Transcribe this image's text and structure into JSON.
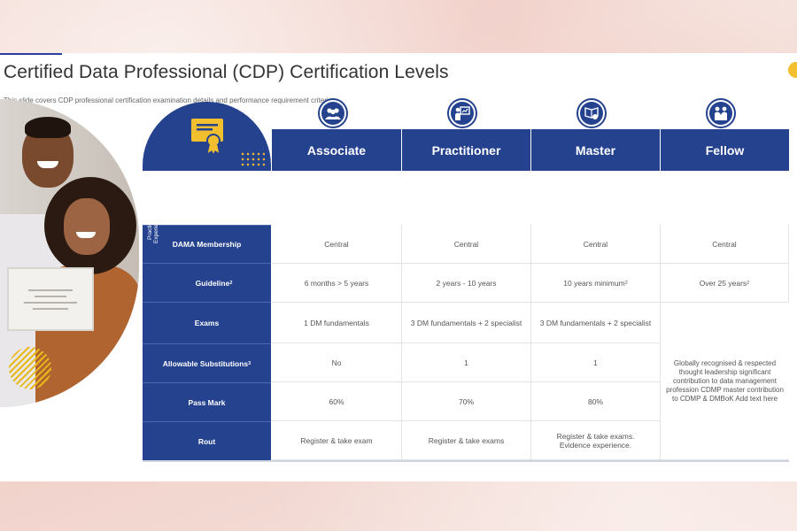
{
  "slide": {
    "title": "Certified Data Professional (CDP) Certification Levels",
    "subtitle": "This slide covers CDP professional certification examination details and performance requirement criteria"
  },
  "photo": {
    "alt_icon": "people-photo"
  },
  "colors": {
    "primary": "#25428f",
    "accent": "#f2c02e",
    "background": "#f4dcd6"
  },
  "table": {
    "header_icon": "certificate-icon",
    "levels": [
      {
        "name": "Associate",
        "icon": "team-icon"
      },
      {
        "name": "Practitioner",
        "icon": "presentation-icon"
      },
      {
        "name": "Master",
        "icon": "book-hand-icon"
      },
      {
        "name": "Fellow",
        "icon": "handshake-icon"
      }
    ],
    "practical_experience_label": "Practical Experience",
    "rows": [
      {
        "label": "DAMA Membership",
        "sup": "",
        "cells": [
          {
            "text": "Central",
            "sup": ""
          },
          {
            "text": "Central",
            "sup": ""
          },
          {
            "text": "Central",
            "sup": ""
          },
          {
            "text": "Central",
            "sup": ""
          }
        ]
      },
      {
        "label": "Guideline",
        "sup": "2",
        "cells": [
          {
            "text": "6 months > 5 years",
            "sup": ""
          },
          {
            "text": "2 years - 10 years",
            "sup": ""
          },
          {
            "text": "10 years minimum",
            "sup": "2"
          },
          {
            "text": "Over 25 years",
            "sup": "2"
          }
        ]
      },
      {
        "label": "Exams",
        "sup": "",
        "cells": [
          {
            "text": "1 DM fundamentals",
            "sup": ""
          },
          {
            "text": "3 DM fundamentals + 2 specialist",
            "sup": ""
          },
          {
            "text": "3 DM fundamentals + 2 specialist",
            "sup": ""
          }
        ]
      },
      {
        "label": "Allowable Substitutions",
        "sup": "3",
        "cells": [
          {
            "text": "No",
            "sup": ""
          },
          {
            "text": "1",
            "sup": ""
          },
          {
            "text": "1",
            "sup": ""
          }
        ]
      },
      {
        "label": "Pass Mark",
        "sup": "",
        "cells": [
          {
            "text": "60%",
            "sup": ""
          },
          {
            "text": "70%",
            "sup": ""
          },
          {
            "text": "80%",
            "sup": ""
          }
        ]
      },
      {
        "label": "Rout",
        "sup": "",
        "cells": [
          {
            "text": "Register & take exam",
            "sup": ""
          },
          {
            "text": "Register & take exams",
            "sup": ""
          },
          {
            "text": "Register & take exams. Evidence experience.",
            "sup": ""
          }
        ]
      }
    ],
    "fellow_merged_text": "Globally recognised & respected thought leadership significant contribution to data management profession CDMP master contribution to CDMP & DMBoK Add text here"
  }
}
